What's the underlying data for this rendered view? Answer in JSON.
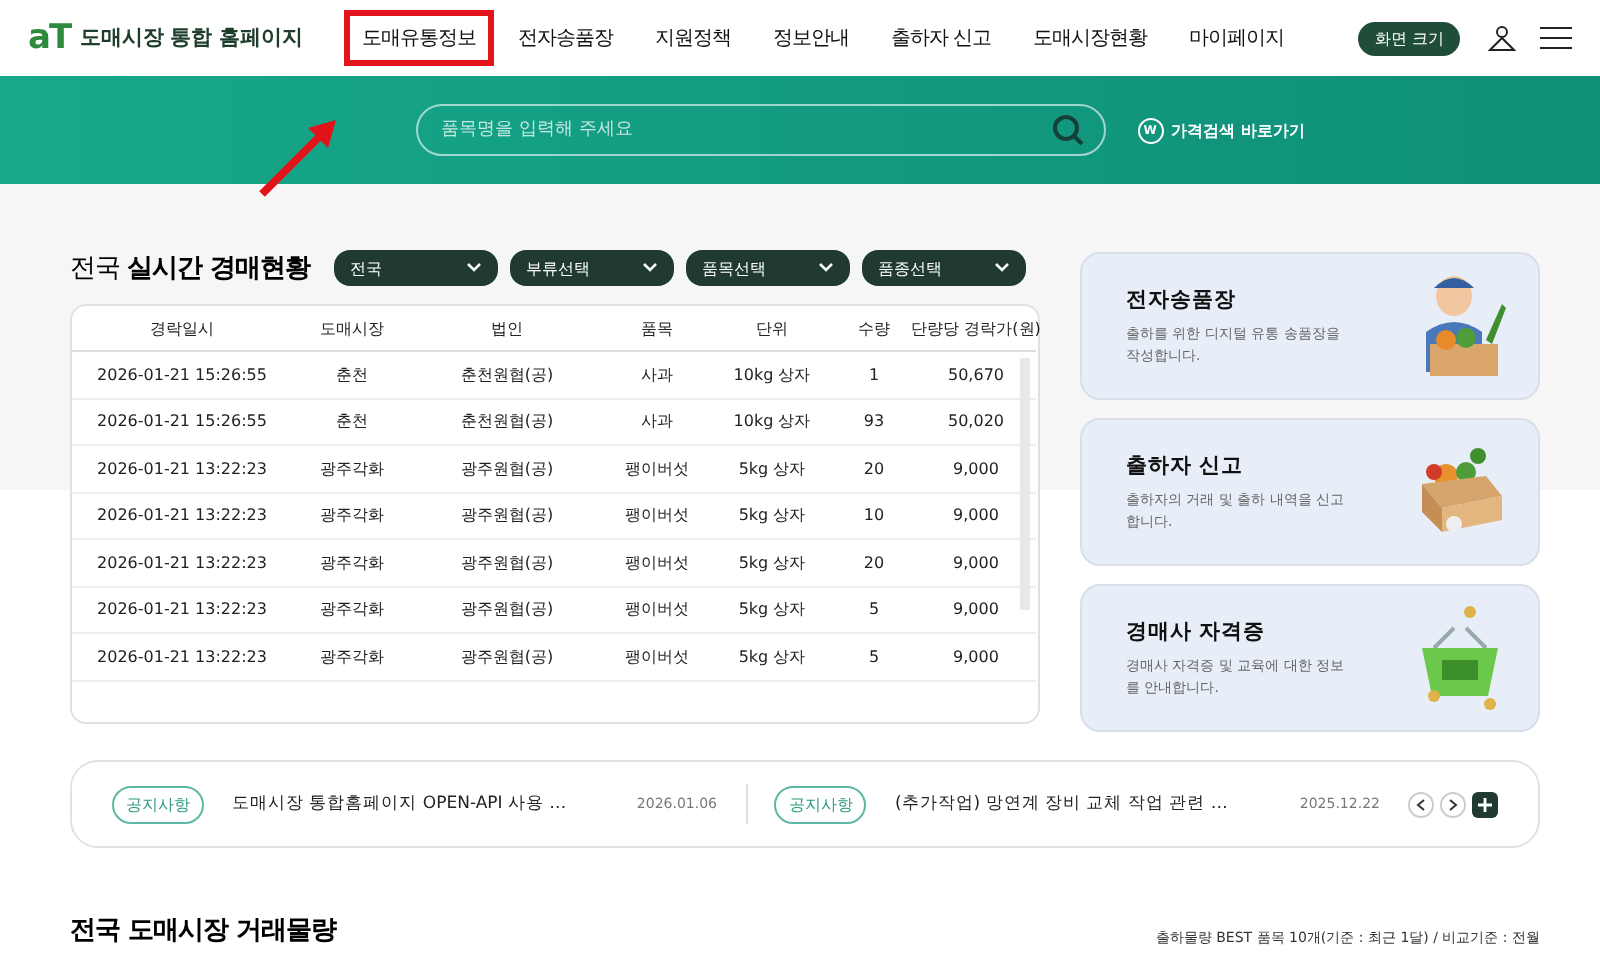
{
  "header": {
    "logo_mark": "aT",
    "site_title": "도매시장 통합 홈페이지",
    "nav": [
      {
        "label": "도매유통정보",
        "highlighted": true
      },
      {
        "label": "전자송품장",
        "highlighted": false
      },
      {
        "label": "지원정책",
        "highlighted": false
      },
      {
        "label": "정보안내",
        "highlighted": false
      },
      {
        "label": "출하자 신고",
        "highlighted": false
      },
      {
        "label": "도매시장현황",
        "highlighted": false
      },
      {
        "label": "마이페이지",
        "highlighted": false
      }
    ],
    "screen_size_button": "화면 크기"
  },
  "banner": {
    "search": {
      "placeholder": "품목명을 입력해 주세요"
    },
    "price_link_badge": "W",
    "price_link": "가격검색 바로가기"
  },
  "auction": {
    "title_prefix": "전국",
    "title": "실시간 경매현황",
    "filters": [
      "전국",
      "부류선택",
      "품목선택",
      "품종선택"
    ],
    "table": {
      "columns": [
        "경락일시",
        "도매시장",
        "법인",
        "품목",
        "단위",
        "수량",
        "단량당 경락가(원)"
      ],
      "rows": [
        [
          "2026-01-21 15:26:55",
          "춘천",
          "춘천원협(공)",
          "사과",
          "10kg 상자",
          "1",
          "50,670"
        ],
        [
          "2026-01-21 15:26:55",
          "춘천",
          "춘천원협(공)",
          "사과",
          "10kg 상자",
          "93",
          "50,020"
        ],
        [
          "2026-01-21 13:22:23",
          "광주각화",
          "광주원협(공)",
          "팽이버섯",
          "5kg 상자",
          "20",
          "9,000"
        ],
        [
          "2026-01-21 13:22:23",
          "광주각화",
          "광주원협(공)",
          "팽이버섯",
          "5kg 상자",
          "10",
          "9,000"
        ],
        [
          "2026-01-21 13:22:23",
          "광주각화",
          "광주원협(공)",
          "팽이버섯",
          "5kg 상자",
          "20",
          "9,000"
        ],
        [
          "2026-01-21 13:22:23",
          "광주각화",
          "광주원협(공)",
          "팽이버섯",
          "5kg 상자",
          "5",
          "9,000"
        ],
        [
          "2026-01-21 13:22:23",
          "광주각화",
          "광주원협(공)",
          "팽이버섯",
          "5kg 상자",
          "5",
          "9,000"
        ]
      ]
    }
  },
  "service_cards": [
    {
      "kind": "courier",
      "title": "전자송품장",
      "description": "출하를 위한 디지털 유통 송품장을 작성합니다."
    },
    {
      "kind": "box",
      "title": "출하자 신고",
      "description": "출하자의 거래 및 출하 내역을 신고합니다."
    },
    {
      "kind": "basket",
      "title": "경매사 자격증",
      "description": "경매사 자격증 및 교육에 대한 정보를 안내합니다."
    }
  ],
  "notices": [
    {
      "tag": "공지사항",
      "title": "도매시장 통합홈페이지 OPEN-API 사용 …",
      "date": "2026.01.06"
    },
    {
      "tag": "공지사항",
      "title": "(추가작업) 망연계 장비 교체 작업 관련 …",
      "date": "2025.12.22"
    }
  ],
  "volume": {
    "title": "전국 도매시장 거래물량",
    "note": "출하물량 BEST 품목 10개(기준 : 최근 1달) / 비교기준 : 전월"
  }
}
